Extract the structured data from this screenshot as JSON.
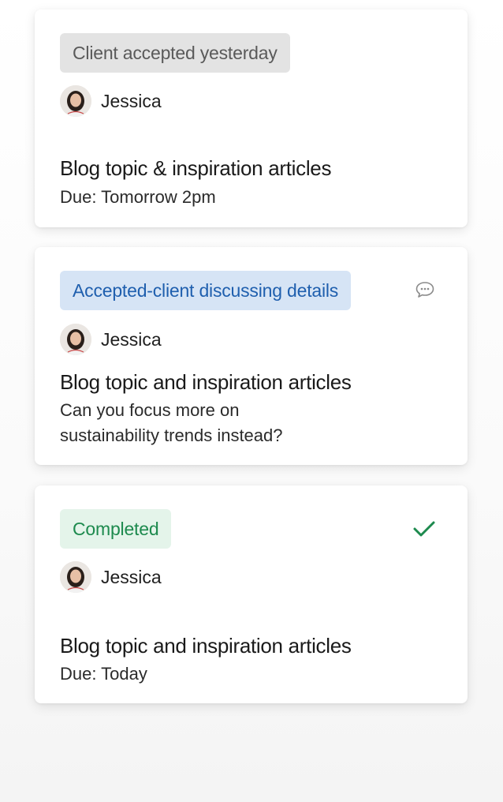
{
  "cards": [
    {
      "status": "Client accepted yesterday",
      "status_bg": "#e3e3e3",
      "status_color": "#5a5a5a",
      "user": "Jessica",
      "title": "Blog topic & inspiration articles",
      "subtitle": "Due: Tomorrow 2pm",
      "icon": null
    },
    {
      "status": "Accepted-client discussing details",
      "status_bg": "#d6e4f5",
      "status_color": "#1f5fae",
      "user": "Jessica",
      "title": "Blog topic and inspiration articles",
      "subtitle_lines": [
        "Can you focus more on",
        "sustainability trends instead?"
      ],
      "icon": "chat-bubble-icon"
    },
    {
      "status": "Completed",
      "status_bg": "#e4f4ea",
      "status_color": "#1d8a4e",
      "user": "Jessica",
      "title": "Blog topic and inspiration articles",
      "subtitle": "Due: Today",
      "icon": "checkmark-icon",
      "icon_color": "#1d8a4e"
    }
  ]
}
